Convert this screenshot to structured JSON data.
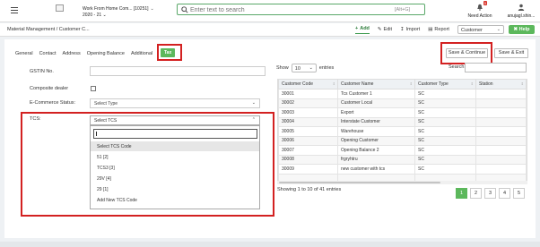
{
  "header": {
    "company": "Work From Home Com... [10251]",
    "year": "2020 - 21",
    "search_placeholder": "Enter text to search",
    "search_shortcut": "[Alt+G]",
    "need_action_label": "Need Action",
    "need_action_count": "0",
    "user_label": "anujagl.shin..."
  },
  "subheader": {
    "breadcrumb": "Material Management / Customer C...",
    "add_label": "Add",
    "edit_label": "Edit",
    "import_label": "Import",
    "report_label": "Report",
    "type_value": "Customer",
    "help_label": "Help"
  },
  "tabs": [
    "General",
    "Contact",
    "Address",
    "Opening Balance",
    "Additional"
  ],
  "active_tab": "Tax",
  "buttons": {
    "save_continue": "Save & Continue",
    "save_exit": "Save & Exit"
  },
  "form": {
    "gstin_label": "GSTIN No.",
    "composite_label": "Composite dealer",
    "ecommerce_label": "E-Commerce Status:",
    "ecommerce_value": "Select Type",
    "tcs_label": "TCS:",
    "tcs_value": "Select TCS"
  },
  "tcs_options": [
    "Select TCS Code",
    "51 [2]",
    "TCS3 [3]",
    "29V [4]",
    "29 [1]",
    "Add New TCS Code"
  ],
  "table": {
    "show_label": "Show",
    "show_value": "10",
    "entries_label": "entries",
    "search_label": "Search:",
    "columns": [
      "Customer Code",
      "Customer Name",
      "Customer Type",
      "Station"
    ],
    "rows": [
      [
        "30001",
        "Tcs Customer 1",
        "SC",
        ""
      ],
      [
        "30002",
        "Customer Local",
        "SC",
        ""
      ],
      [
        "30003",
        "Export",
        "SC",
        ""
      ],
      [
        "30004",
        "Interstate Customer",
        "SC",
        ""
      ],
      [
        "30005",
        "Warehouse",
        "SC",
        ""
      ],
      [
        "30006",
        "Opening Customer",
        "SC",
        ""
      ],
      [
        "30007",
        "Opening Balance 2",
        "SC",
        ""
      ],
      [
        "30008",
        "frgryhtru",
        "SC",
        ""
      ],
      [
        "30009",
        "new customer with tcs",
        "SC",
        ""
      ],
      [
        "",
        "",
        "",
        ""
      ]
    ],
    "info": "Showing 1 to 10 of 41 entries",
    "pages": [
      "1",
      "2",
      "3",
      "4",
      "5"
    ]
  }
}
